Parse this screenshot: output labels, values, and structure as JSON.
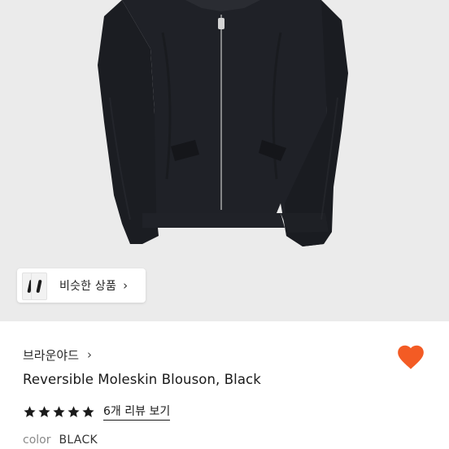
{
  "similar": {
    "label": "비슷한 상품",
    "chevron": "›"
  },
  "brand": {
    "name": "브라운야드",
    "chevron": "›"
  },
  "product": {
    "title": "Reversible Moleskin Blouson, Black",
    "rating": 5,
    "review_link": "6개 리뷰 보기",
    "color_key": "color",
    "color_value": "BLACK"
  },
  "icons": {
    "like": "heart-icon",
    "star": "star-icon",
    "chevron": "chevron-right-icon"
  },
  "colors": {
    "image_bg": "#ebebeb",
    "garment": "#1d1f24",
    "heart": "#f35b24",
    "star": "#1a1a1a"
  }
}
